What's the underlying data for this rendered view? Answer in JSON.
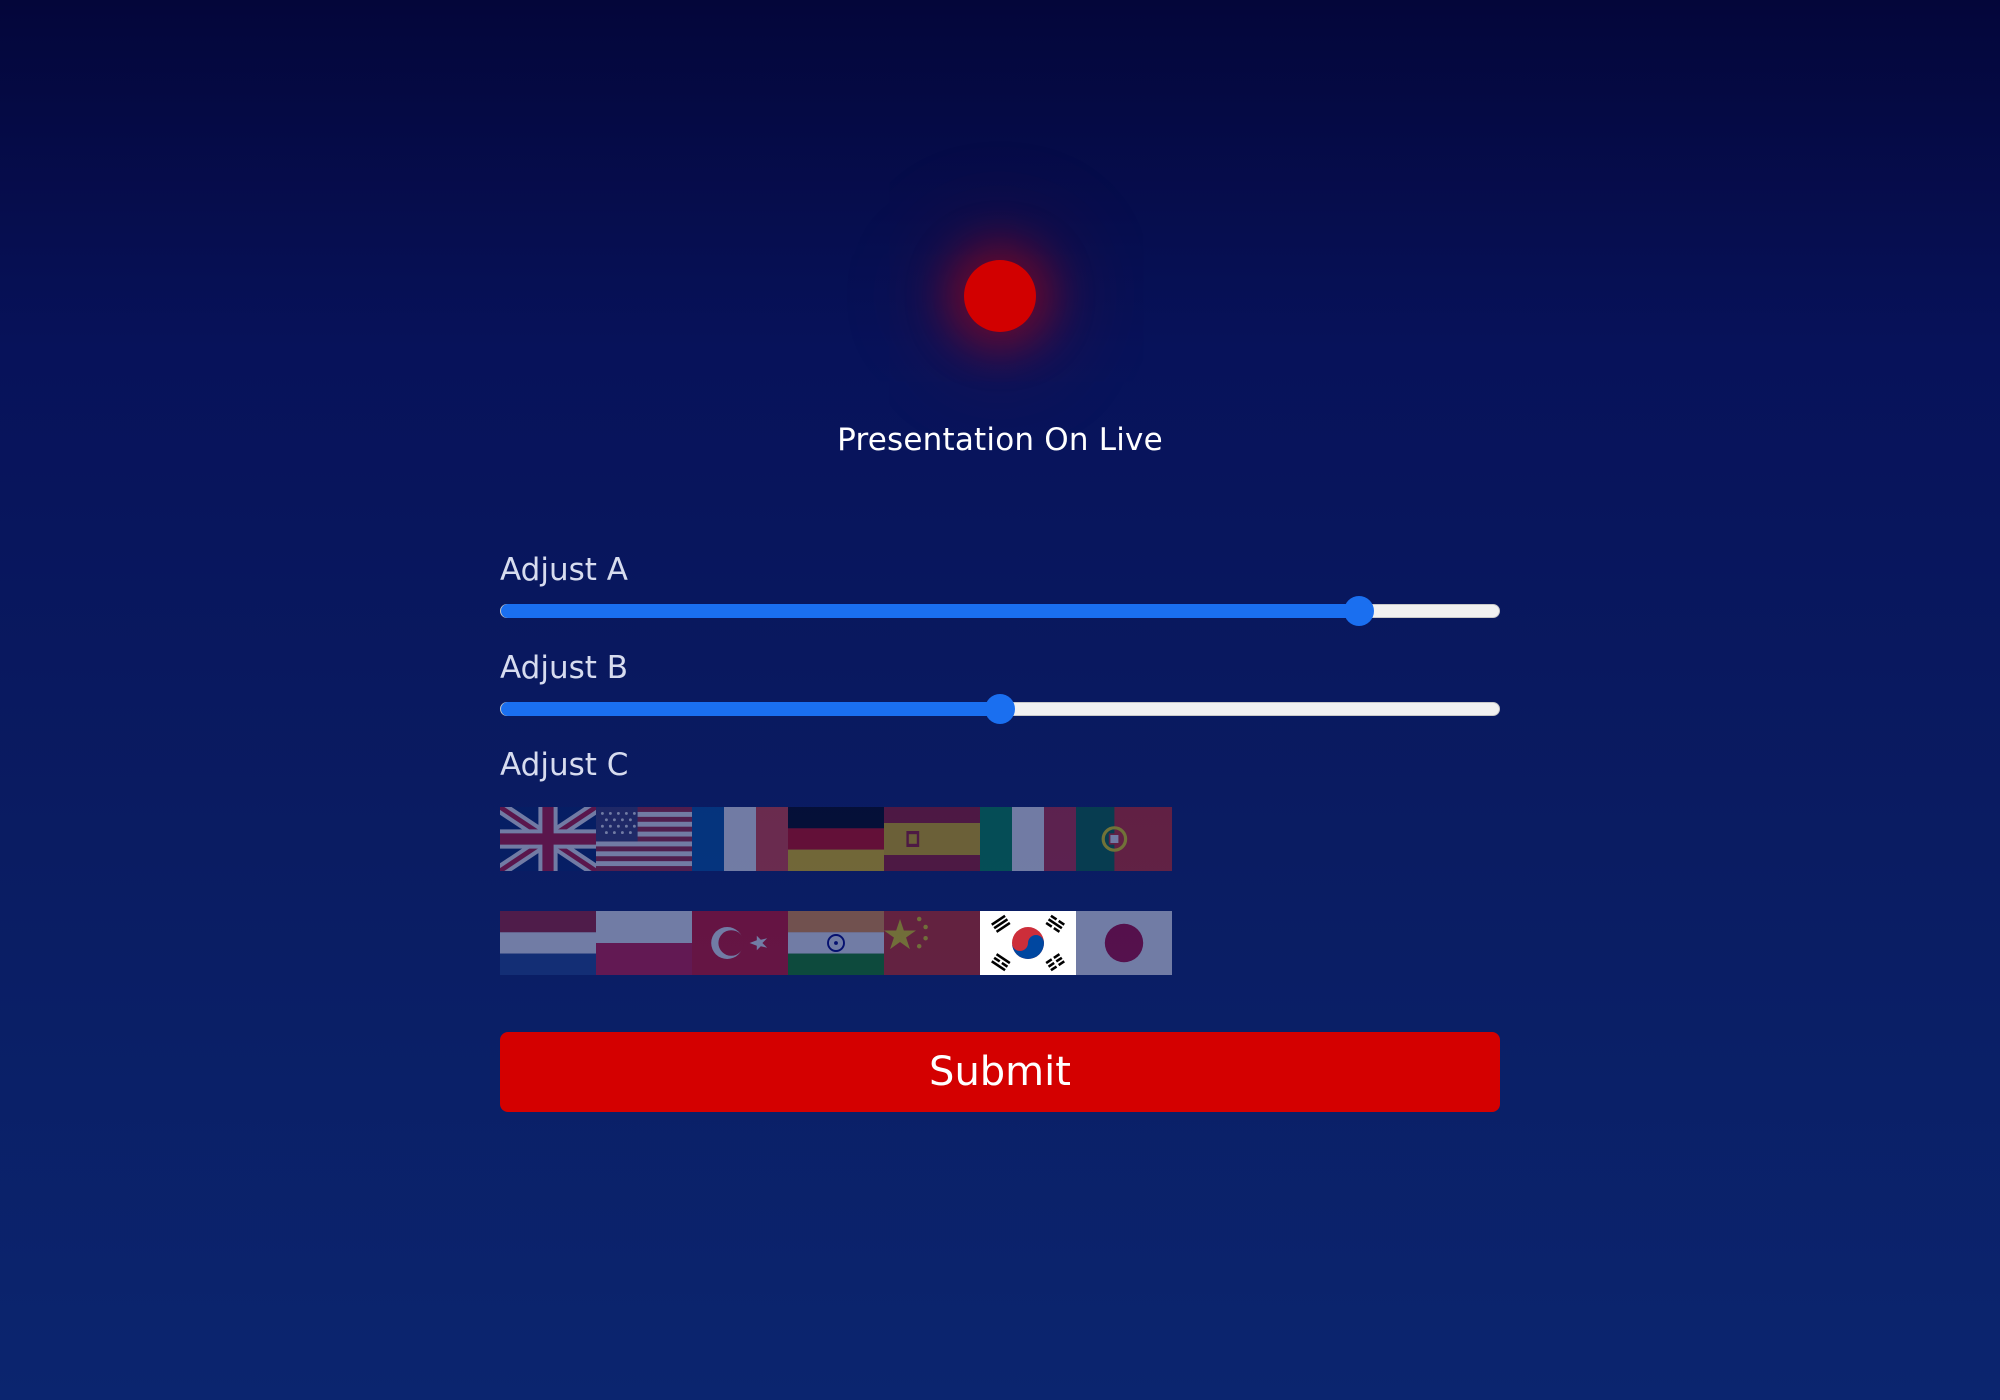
{
  "header": {
    "title": "Presentation On Live",
    "live_indicator_color": "#d20000"
  },
  "controls": {
    "adjust_a": {
      "label": "Adjust A",
      "value_percent": 86
    },
    "adjust_b": {
      "label": "Adjust B",
      "value_percent": 50
    },
    "adjust_c": {
      "label": "Adjust C",
      "selected": "south-korea",
      "flags_row1": [
        "united-kingdom",
        "united-states",
        "france",
        "germany",
        "spain",
        "italy",
        "portugal"
      ],
      "flags_row2": [
        "netherlands",
        "poland",
        "turkey",
        "india",
        "china",
        "south-korea",
        "japan"
      ]
    }
  },
  "submit": {
    "label": "Submit"
  },
  "colors": {
    "accent": "#1a6ff0",
    "submit_bg": "#d40000"
  }
}
